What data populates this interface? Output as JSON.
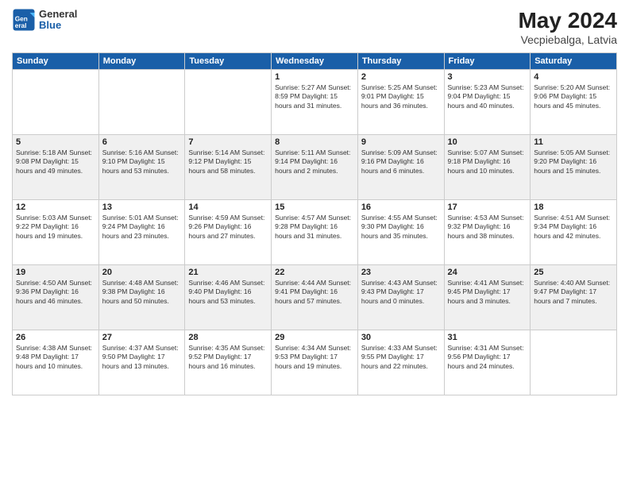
{
  "header": {
    "logo_general": "General",
    "logo_blue": "Blue",
    "title": "May 2024",
    "location": "Vecpiebalga, Latvia"
  },
  "days_of_week": [
    "Sunday",
    "Monday",
    "Tuesday",
    "Wednesday",
    "Thursday",
    "Friday",
    "Saturday"
  ],
  "weeks": [
    [
      {
        "num": "",
        "detail": ""
      },
      {
        "num": "",
        "detail": ""
      },
      {
        "num": "",
        "detail": ""
      },
      {
        "num": "1",
        "detail": "Sunrise: 5:27 AM\nSunset: 8:59 PM\nDaylight: 15 hours\nand 31 minutes."
      },
      {
        "num": "2",
        "detail": "Sunrise: 5:25 AM\nSunset: 9:01 PM\nDaylight: 15 hours\nand 36 minutes."
      },
      {
        "num": "3",
        "detail": "Sunrise: 5:23 AM\nSunset: 9:04 PM\nDaylight: 15 hours\nand 40 minutes."
      },
      {
        "num": "4",
        "detail": "Sunrise: 5:20 AM\nSunset: 9:06 PM\nDaylight: 15 hours\nand 45 minutes."
      }
    ],
    [
      {
        "num": "5",
        "detail": "Sunrise: 5:18 AM\nSunset: 9:08 PM\nDaylight: 15 hours\nand 49 minutes."
      },
      {
        "num": "6",
        "detail": "Sunrise: 5:16 AM\nSunset: 9:10 PM\nDaylight: 15 hours\nand 53 minutes."
      },
      {
        "num": "7",
        "detail": "Sunrise: 5:14 AM\nSunset: 9:12 PM\nDaylight: 15 hours\nand 58 minutes."
      },
      {
        "num": "8",
        "detail": "Sunrise: 5:11 AM\nSunset: 9:14 PM\nDaylight: 16 hours\nand 2 minutes."
      },
      {
        "num": "9",
        "detail": "Sunrise: 5:09 AM\nSunset: 9:16 PM\nDaylight: 16 hours\nand 6 minutes."
      },
      {
        "num": "10",
        "detail": "Sunrise: 5:07 AM\nSunset: 9:18 PM\nDaylight: 16 hours\nand 10 minutes."
      },
      {
        "num": "11",
        "detail": "Sunrise: 5:05 AM\nSunset: 9:20 PM\nDaylight: 16 hours\nand 15 minutes."
      }
    ],
    [
      {
        "num": "12",
        "detail": "Sunrise: 5:03 AM\nSunset: 9:22 PM\nDaylight: 16 hours\nand 19 minutes."
      },
      {
        "num": "13",
        "detail": "Sunrise: 5:01 AM\nSunset: 9:24 PM\nDaylight: 16 hours\nand 23 minutes."
      },
      {
        "num": "14",
        "detail": "Sunrise: 4:59 AM\nSunset: 9:26 PM\nDaylight: 16 hours\nand 27 minutes."
      },
      {
        "num": "15",
        "detail": "Sunrise: 4:57 AM\nSunset: 9:28 PM\nDaylight: 16 hours\nand 31 minutes."
      },
      {
        "num": "16",
        "detail": "Sunrise: 4:55 AM\nSunset: 9:30 PM\nDaylight: 16 hours\nand 35 minutes."
      },
      {
        "num": "17",
        "detail": "Sunrise: 4:53 AM\nSunset: 9:32 PM\nDaylight: 16 hours\nand 38 minutes."
      },
      {
        "num": "18",
        "detail": "Sunrise: 4:51 AM\nSunset: 9:34 PM\nDaylight: 16 hours\nand 42 minutes."
      }
    ],
    [
      {
        "num": "19",
        "detail": "Sunrise: 4:50 AM\nSunset: 9:36 PM\nDaylight: 16 hours\nand 46 minutes."
      },
      {
        "num": "20",
        "detail": "Sunrise: 4:48 AM\nSunset: 9:38 PM\nDaylight: 16 hours\nand 50 minutes."
      },
      {
        "num": "21",
        "detail": "Sunrise: 4:46 AM\nSunset: 9:40 PM\nDaylight: 16 hours\nand 53 minutes."
      },
      {
        "num": "22",
        "detail": "Sunrise: 4:44 AM\nSunset: 9:41 PM\nDaylight: 16 hours\nand 57 minutes."
      },
      {
        "num": "23",
        "detail": "Sunrise: 4:43 AM\nSunset: 9:43 PM\nDaylight: 17 hours\nand 0 minutes."
      },
      {
        "num": "24",
        "detail": "Sunrise: 4:41 AM\nSunset: 9:45 PM\nDaylight: 17 hours\nand 3 minutes."
      },
      {
        "num": "25",
        "detail": "Sunrise: 4:40 AM\nSunset: 9:47 PM\nDaylight: 17 hours\nand 7 minutes."
      }
    ],
    [
      {
        "num": "26",
        "detail": "Sunrise: 4:38 AM\nSunset: 9:48 PM\nDaylight: 17 hours\nand 10 minutes."
      },
      {
        "num": "27",
        "detail": "Sunrise: 4:37 AM\nSunset: 9:50 PM\nDaylight: 17 hours\nand 13 minutes."
      },
      {
        "num": "28",
        "detail": "Sunrise: 4:35 AM\nSunset: 9:52 PM\nDaylight: 17 hours\nand 16 minutes."
      },
      {
        "num": "29",
        "detail": "Sunrise: 4:34 AM\nSunset: 9:53 PM\nDaylight: 17 hours\nand 19 minutes."
      },
      {
        "num": "30",
        "detail": "Sunrise: 4:33 AM\nSunset: 9:55 PM\nDaylight: 17 hours\nand 22 minutes."
      },
      {
        "num": "31",
        "detail": "Sunrise: 4:31 AM\nSunset: 9:56 PM\nDaylight: 17 hours\nand 24 minutes."
      },
      {
        "num": "",
        "detail": ""
      }
    ]
  ]
}
